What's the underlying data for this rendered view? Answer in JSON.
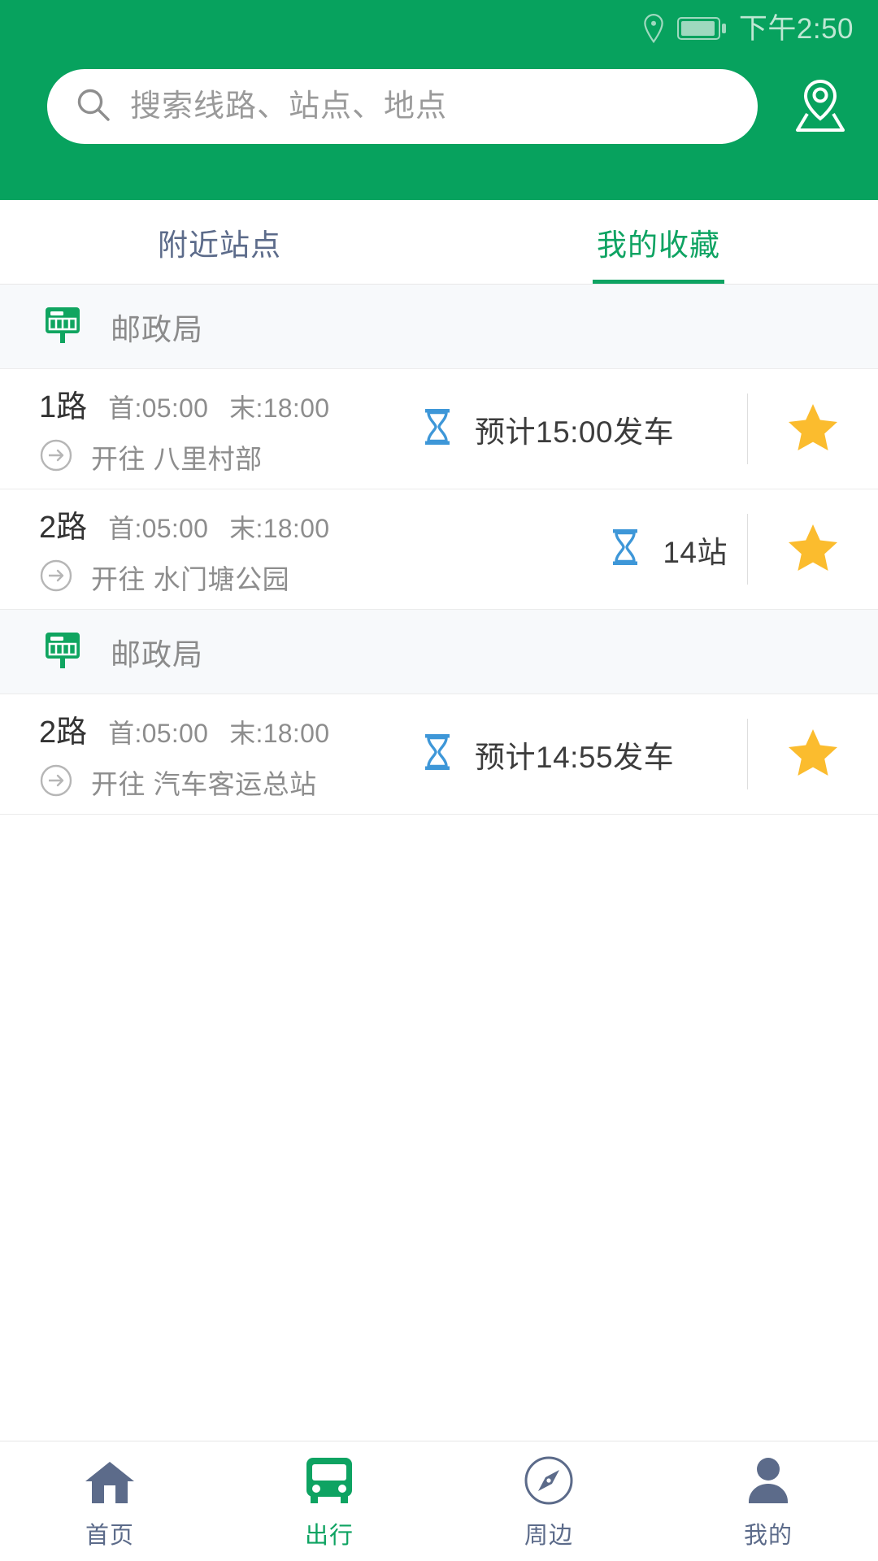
{
  "status_bar": {
    "location_icon": "location-pin-icon",
    "battery_icon": "battery-icon",
    "time": "下午2:50"
  },
  "header": {
    "background_color": "#07A25E",
    "search": {
      "icon": "search-icon",
      "placeholder": "搜索线路、站点、地点",
      "value": ""
    },
    "map_button_icon": "map-location-icon"
  },
  "tabs": [
    {
      "label": "附近站点",
      "active": false
    },
    {
      "label": "我的收藏",
      "active": true
    }
  ],
  "tab_colors": {
    "active": "#0EA362",
    "inactive": "#5C6B8A"
  },
  "groups": [
    {
      "station_icon": "bus-stop-sign-icon",
      "station_name": "邮政局",
      "routes": [
        {
          "route_no": "1路",
          "first_time": "首:05:00",
          "last_time": "末:18:00",
          "direction_icon": "arrow-right-circle-icon",
          "destination": "开往 八里村部",
          "eta_icon": "hourglass-icon",
          "eta_text": "预计15:00发车",
          "eta_align": "left",
          "favorite_icon": "star-filled-icon",
          "favorited": true
        },
        {
          "route_no": "2路",
          "first_time": "首:05:00",
          "last_time": "末:18:00",
          "direction_icon": "arrow-right-circle-icon",
          "destination": "开往 水门塘公园",
          "eta_icon": "hourglass-icon",
          "eta_text": "14站",
          "eta_align": "right",
          "favorite_icon": "star-filled-icon",
          "favorited": true
        }
      ]
    },
    {
      "station_icon": "bus-stop-sign-icon",
      "station_name": "邮政局",
      "routes": [
        {
          "route_no": "2路",
          "first_time": "首:05:00",
          "last_time": "末:18:00",
          "direction_icon": "arrow-right-circle-icon",
          "destination": "开往 汽车客运总站",
          "eta_icon": "hourglass-icon",
          "eta_text": "预计14:55发车",
          "eta_align": "left",
          "favorite_icon": "star-filled-icon",
          "favorited": true
        }
      ]
    }
  ],
  "colors": {
    "brand_green": "#0EA362",
    "header_green": "#07A25E",
    "star_gold": "#FBBC2E",
    "eta_blue": "#3E97D8",
    "slate": "#5C6B8A",
    "station_bg": "#F7F9FB"
  },
  "bottom_nav": [
    {
      "label": "首页",
      "icon": "home-icon",
      "active": false
    },
    {
      "label": "出行",
      "icon": "bus-icon",
      "active": true
    },
    {
      "label": "周边",
      "icon": "compass-icon",
      "active": false
    },
    {
      "label": "我的",
      "icon": "person-icon",
      "active": false
    }
  ]
}
